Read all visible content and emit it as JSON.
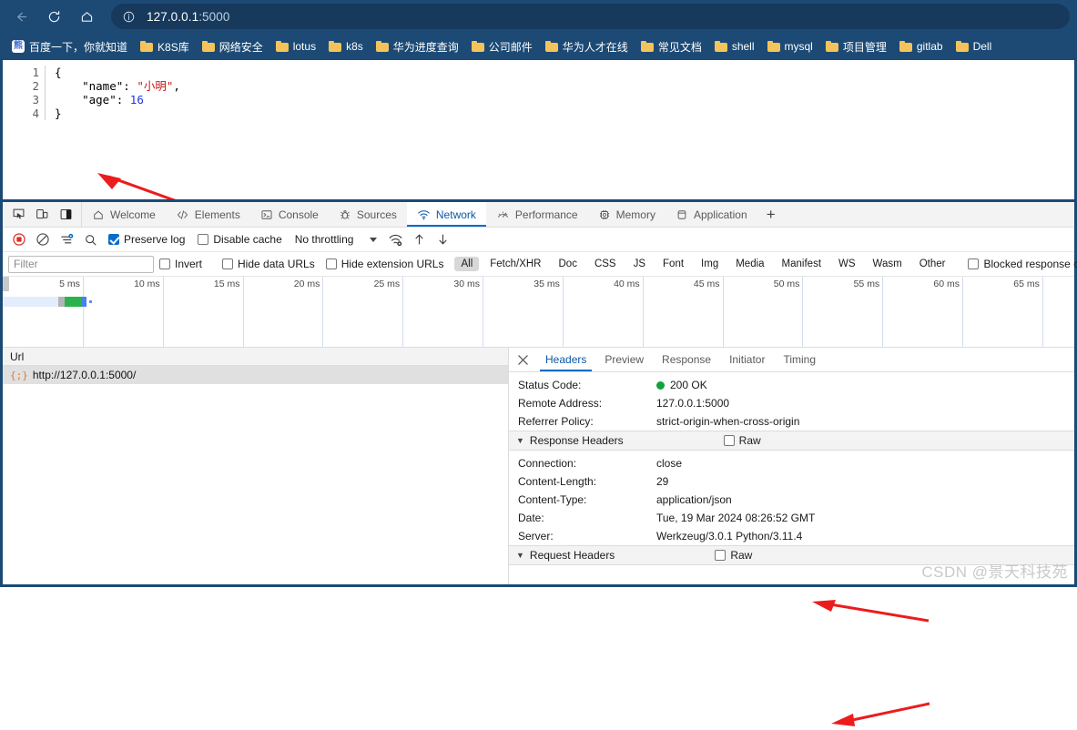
{
  "browser": {
    "nav": {
      "back": "back-arrow",
      "reload": "reload",
      "home": "home"
    },
    "omnibox": {
      "info_icon": "info-circle-icon",
      "url_host": "127.0.0.1",
      "url_port": ":5000"
    },
    "bookmarks": [
      {
        "label": "百度一下，你就知道",
        "icon": "baidu-icon"
      },
      {
        "label": "K8S库",
        "icon": "folder-icon"
      },
      {
        "label": "网络安全",
        "icon": "folder-icon"
      },
      {
        "label": "lotus",
        "icon": "folder-icon"
      },
      {
        "label": "k8s",
        "icon": "folder-icon"
      },
      {
        "label": "华为进度查询",
        "icon": "folder-icon"
      },
      {
        "label": "公司邮件",
        "icon": "folder-icon"
      },
      {
        "label": "华为人才在线",
        "icon": "folder-icon"
      },
      {
        "label": "常见文档",
        "icon": "folder-icon"
      },
      {
        "label": "shell",
        "icon": "folder-icon"
      },
      {
        "label": "mysql",
        "icon": "folder-icon"
      },
      {
        "label": "项目管理",
        "icon": "folder-icon"
      },
      {
        "label": "gitlab",
        "icon": "folder-icon"
      },
      {
        "label": "Dell",
        "icon": "folder-icon"
      }
    ]
  },
  "page": {
    "json_lines": [
      {
        "num": "1",
        "text": "{"
      },
      {
        "num": "2",
        "key": "    \"name\":",
        "str": " \"小明\"",
        "tail": ","
      },
      {
        "num": "3",
        "key": "    \"age\":",
        "num_val": " 16",
        "tail": ""
      },
      {
        "num": "4",
        "text": "}"
      }
    ]
  },
  "devtools": {
    "tool_icons": [
      "inspect-element-icon",
      "device-toolbar-icon",
      "dock-side-icon"
    ],
    "tabs": [
      {
        "label": "Welcome",
        "icon": "home-icon",
        "active": false
      },
      {
        "label": "Elements",
        "icon": "code-brackets-icon",
        "active": false
      },
      {
        "label": "Console",
        "icon": "terminal-icon",
        "active": false
      },
      {
        "label": "Sources",
        "icon": "bug-icon",
        "active": false
      },
      {
        "label": "Network",
        "icon": "network-wifi-icon",
        "active": true
      },
      {
        "label": "Performance",
        "icon": "speedometer-icon",
        "active": false
      },
      {
        "label": "Memory",
        "icon": "chip-icon",
        "active": false
      },
      {
        "label": "Application",
        "icon": "database-icon",
        "active": false
      }
    ],
    "add_tab": "+",
    "network_toolbar": {
      "record_icon": "record-stop-icon",
      "clear_icon": "clear-no-entry-icon",
      "filter_icon": "filter-settings-icon",
      "search_icon": "search-icon",
      "preserve_log_label": "Preserve log",
      "preserve_log_checked": true,
      "disable_cache_label": "Disable cache",
      "disable_cache_checked": false,
      "throttling_value": "No throttling",
      "network_conditions_icon": "network-conditions-icon",
      "import_icon": "import-har-icon",
      "export_icon": "export-har-icon"
    },
    "filter_row": {
      "filter_placeholder": "Filter",
      "filter_value": "",
      "invert_label": "Invert",
      "invert_checked": false,
      "hide_data_urls_label": "Hide data URLs",
      "hide_data_urls_checked": false,
      "hide_extension_urls_label": "Hide extension URLs",
      "hide_extension_urls_checked": false,
      "types": [
        {
          "label": "All",
          "selected": true
        },
        {
          "label": "Fetch/XHR",
          "selected": false
        },
        {
          "label": "Doc",
          "selected": false
        },
        {
          "label": "CSS",
          "selected": false
        },
        {
          "label": "JS",
          "selected": false
        },
        {
          "label": "Font",
          "selected": false
        },
        {
          "label": "Img",
          "selected": false
        },
        {
          "label": "Media",
          "selected": false
        },
        {
          "label": "Manifest",
          "selected": false
        },
        {
          "label": "WS",
          "selected": false
        },
        {
          "label": "Wasm",
          "selected": false
        },
        {
          "label": "Other",
          "selected": false
        }
      ],
      "blocked_cookies_label": "Blocked response cookies",
      "blocked_cookies_checked": false
    },
    "timeline": {
      "ticks": [
        "5 ms",
        "10 ms",
        "15 ms",
        "20 ms",
        "25 ms",
        "30 ms",
        "35 ms",
        "40 ms",
        "45 ms",
        "50 ms",
        "55 ms",
        "60 ms",
        "65 ms"
      ],
      "waterfall_colors": {
        "stalled": "#b4b4b4",
        "waiting": "#2bb24c",
        "download": "#4a7ff0",
        "line": "#e4edfb"
      }
    },
    "requests": {
      "column_header": "Url",
      "rows": [
        {
          "icon": "json-document-icon",
          "url": "http://127.0.0.1:5000/",
          "selected": true
        }
      ]
    },
    "details": {
      "close_icon": "close-icon",
      "tabs": [
        {
          "label": "Headers",
          "active": true
        },
        {
          "label": "Preview",
          "active": false
        },
        {
          "label": "Response",
          "active": false
        },
        {
          "label": "Initiator",
          "active": false
        },
        {
          "label": "Timing",
          "active": false
        }
      ],
      "general": [
        {
          "key": "Status Code:",
          "value": "200 OK",
          "dot": true
        },
        {
          "key": "Remote Address:",
          "value": "127.0.0.1:5000",
          "dot": false
        },
        {
          "key": "Referrer Policy:",
          "value": "strict-origin-when-cross-origin",
          "dot": false
        }
      ],
      "response_headers_title": "Response Headers",
      "raw_label": "Raw",
      "raw_checked": false,
      "response_headers": [
        {
          "key": "Connection:",
          "value": "close"
        },
        {
          "key": "Content-Length:",
          "value": "29"
        },
        {
          "key": "Content-Type:",
          "value": "application/json"
        },
        {
          "key": "Date:",
          "value": "Tue, 19 Mar 2024 08:26:52 GMT"
        },
        {
          "key": "Server:",
          "value": "Werkzeug/3.0.1 Python/3.11.4"
        }
      ],
      "request_headers_title": "Request Headers",
      "request_raw_label": "Raw",
      "request_raw_checked": false
    }
  },
  "watermark": "CSDN @景天科技苑",
  "colors": {
    "chrome_blue": "#1c4a75",
    "accent_blue": "#0a6cc9",
    "status_green": "#12a13a",
    "annotation_red": "#ec1c1c",
    "json_string_red": "#c41a16",
    "json_number_blue": "#1a36e8"
  }
}
